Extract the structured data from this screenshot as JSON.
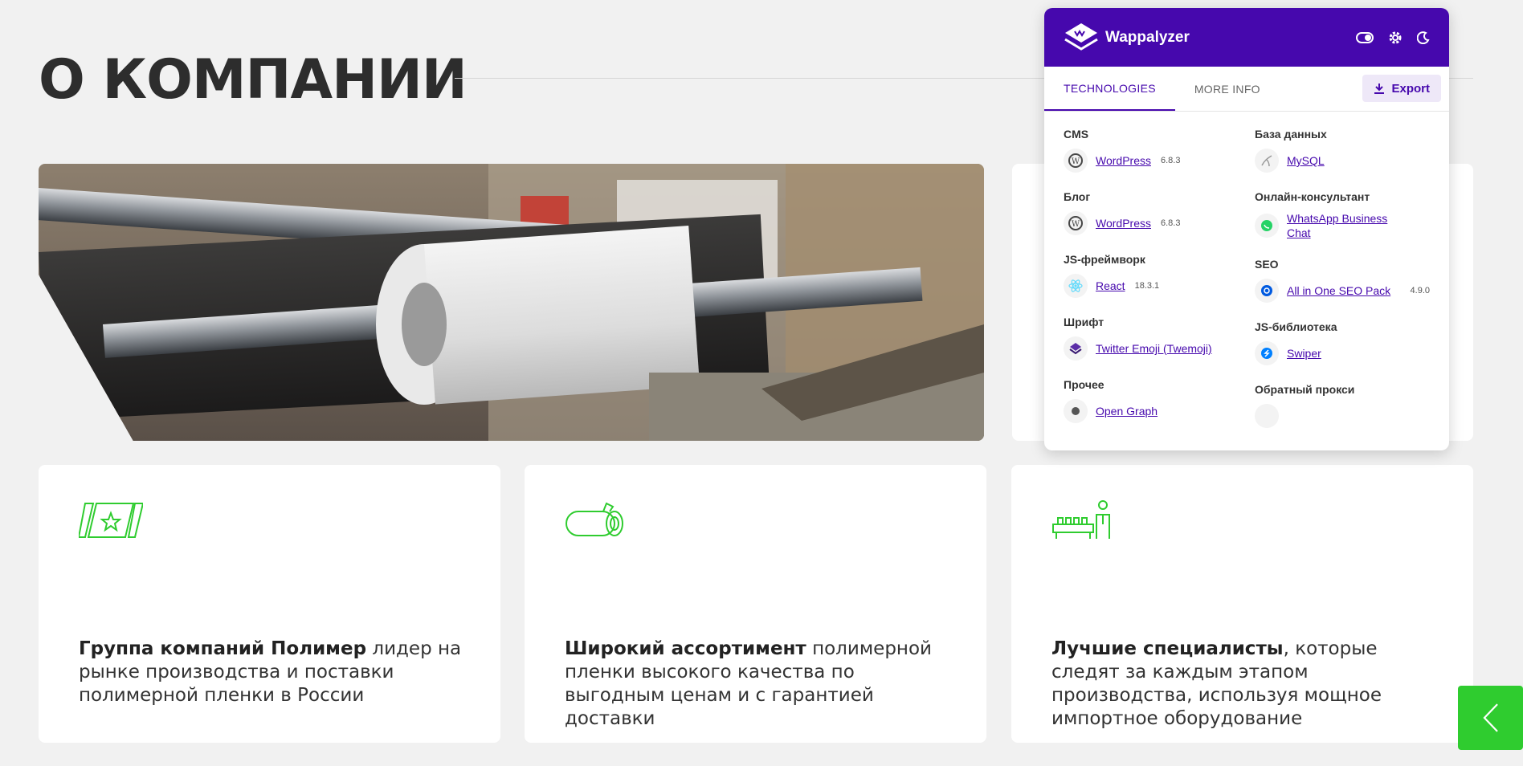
{
  "page": {
    "title": "О КОМПАНИИ"
  },
  "cards": [
    {
      "icon": "flag-star-icon",
      "bold": "Группа компаний Полимер",
      "rest": " лидер на рынке производства и поставки полимерной пленки в России"
    },
    {
      "icon": "film-roll-icon",
      "bold": "Широкий ассортимент",
      "rest": " полимерной пленки высокого качества по выгодным ценам и с гарантией доставки"
    },
    {
      "icon": "worker-machine-icon",
      "bold": "Лучшие специалисты",
      "rest": ", которые следят за каждым этапом производства, используя мощное импортное оборудование"
    }
  ],
  "wappalyzer": {
    "brand": "Wappalyzer",
    "tabs": {
      "technologies": "TECHNOLOGIES",
      "more_info": "MORE INFO"
    },
    "export_label": "Export",
    "left": [
      {
        "category": "CMS",
        "name": "WordPress",
        "version": "6.8.3",
        "icon": "wordpress-icon"
      },
      {
        "category": "Блог",
        "name": "WordPress",
        "version": "6.8.3",
        "icon": "wordpress-icon"
      },
      {
        "category": "JS-фреймворк",
        "name": "React",
        "version": "18.3.1",
        "icon": "react-icon"
      },
      {
        "category": "Шрифт",
        "name": "Twitter Emoji (Twemoji)",
        "version": "",
        "icon": "twemoji-icon"
      },
      {
        "category": "Прочее",
        "name": "Open Graph",
        "version": "",
        "icon": "open-graph-icon"
      }
    ],
    "right": [
      {
        "category": "База данных",
        "name": "MySQL",
        "version": "",
        "icon": "mysql-icon"
      },
      {
        "category": "Онлайн-консультант",
        "name": "WhatsApp Business Chat",
        "version": "",
        "icon": "whatsapp-icon"
      },
      {
        "category": "SEO",
        "name": "All in One SEO Pack",
        "version": "4.9.0",
        "icon": "aioseo-icon"
      },
      {
        "category": "JS-библиотека",
        "name": "Swiper",
        "version": "",
        "icon": "swiper-icon"
      },
      {
        "category": "Обратный прокси",
        "name": "",
        "version": "",
        "icon": "proxy-icon"
      }
    ]
  },
  "colors": {
    "accent_green": "#2fcc2f",
    "wappalyzer_purple": "#4608ad"
  }
}
